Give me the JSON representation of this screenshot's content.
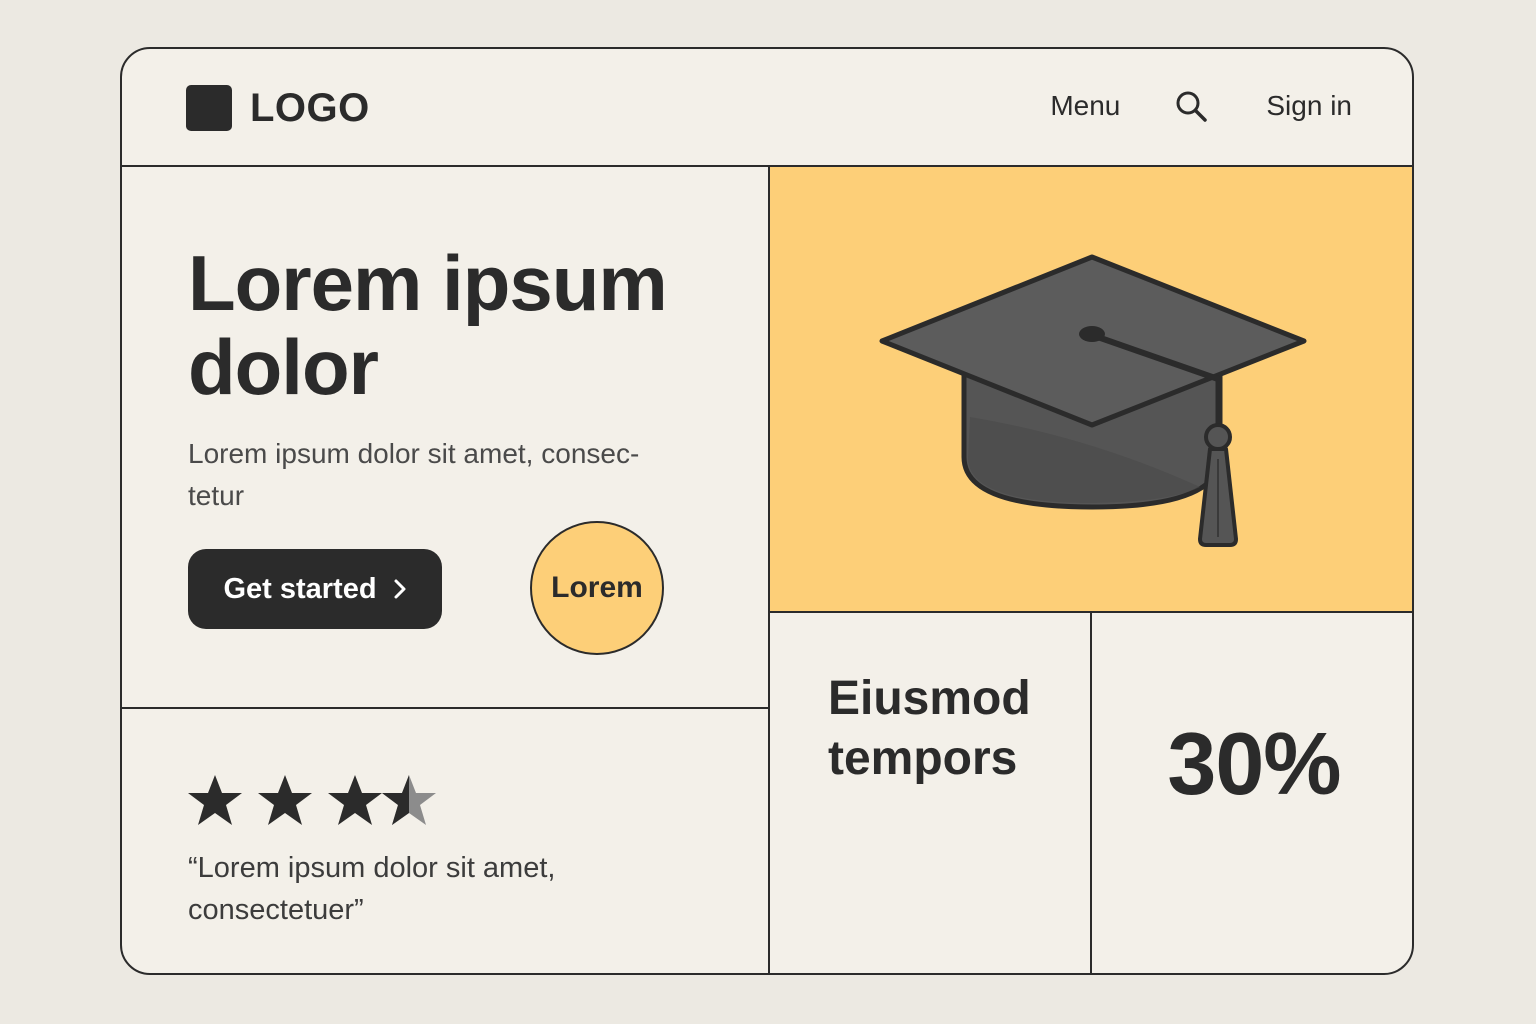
{
  "header": {
    "logo_text": "LOGO",
    "nav": {
      "menu_label": "Menu",
      "search_icon": "search-icon",
      "signin_label": "Sign in"
    }
  },
  "hero": {
    "title": "Lorem ipsum dolor",
    "subtitle": "Lorem ipsum dolor sit amet, consec-tetur",
    "cta_label": "Get started",
    "cta_icon": "chevron-right-icon",
    "circle_label": "Lorem"
  },
  "image": {
    "icon": "graduation-cap-icon",
    "background": "#fdcf78"
  },
  "review": {
    "rating": 3.5,
    "rating_max": 4,
    "quote": "“Lorem ipsum dolor sit amet, consectetuer”"
  },
  "stat": {
    "label": "Eiusmod tempors",
    "value": "30%"
  },
  "colors": {
    "accent": "#fdcf78",
    "dark": "#2b2b2b",
    "panel": "#f3f0e9",
    "page": "#ece9e2"
  }
}
